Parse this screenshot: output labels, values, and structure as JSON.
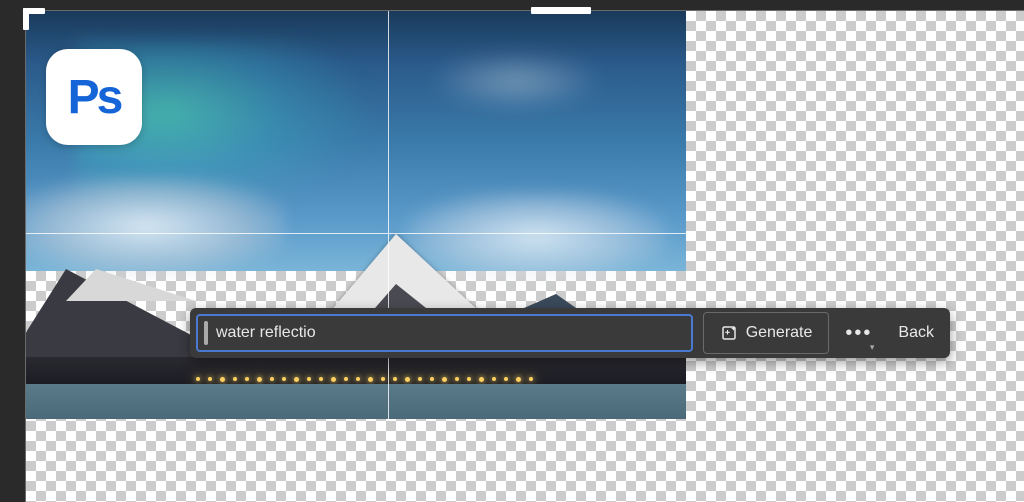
{
  "app": {
    "name": "Photoshop",
    "badge_text": "Ps"
  },
  "prompt": {
    "value": "water reflectio",
    "placeholder": ""
  },
  "toolbar": {
    "generate_label": "Generate",
    "back_label": "Back"
  },
  "icons": {
    "ps": "ps-icon",
    "generate": "generate-sparkle-icon",
    "more": "more-icon"
  }
}
